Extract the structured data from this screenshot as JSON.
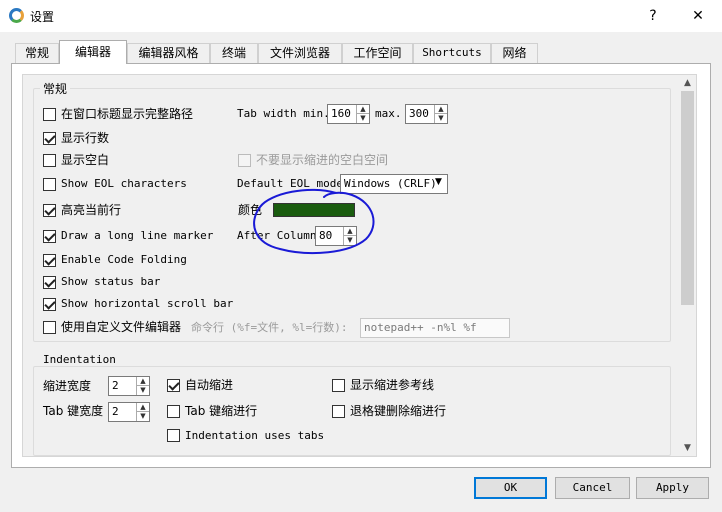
{
  "window": {
    "title": "设置",
    "help": "?",
    "close": "✕"
  },
  "tabs": [
    "常规",
    "编辑器",
    "编辑器风格",
    "终端",
    "文件浏览器",
    "工作空间",
    "Shortcuts",
    "网络"
  ],
  "general": {
    "title": "常规",
    "show_full_path": {
      "label": "在窗口标题显示完整路径",
      "checked": false
    },
    "tab_width_min_label": "Tab width min.",
    "tab_width_min": "160",
    "tab_width_max_label": "max.",
    "tab_width_max": "300",
    "show_line_numbers": {
      "label": "显示行数",
      "checked": true
    },
    "show_whitespace": {
      "label": "显示空白",
      "checked": false
    },
    "hide_indent_whitespace": {
      "label": "不要显示缩进的空白空间",
      "checked": false
    },
    "show_eol": {
      "label": "Show EOL characters",
      "checked": false
    },
    "default_eol_label": "Default EOL mode",
    "default_eol_value": "Windows (CRLF)",
    "highlight_line": {
      "label": "高亮当前行",
      "checked": true
    },
    "color_label": "颜色",
    "highlight_color": "#1a5c0f",
    "long_line_marker": {
      "label": "Draw a long line marker",
      "checked": true
    },
    "after_column_label": "After Column",
    "after_column_value": "80",
    "code_folding": {
      "label": "Enable Code Folding",
      "checked": true
    },
    "status_bar": {
      "label": "Show status bar",
      "checked": true
    },
    "horizontal_scroll": {
      "label": "Show horizontal scroll bar",
      "checked": true
    },
    "custom_editor": {
      "label": "使用自定义文件编辑器",
      "checked": false
    },
    "command_label": "命令行 (%f=文件, %l=行数):",
    "command_value": "notepad++ -n%l %f"
  },
  "indentation": {
    "title": "Indentation",
    "indent_width_label": "缩进宽度",
    "indent_width": "2",
    "tab_width_label": "Tab 键宽度",
    "tab_width": "2",
    "auto_indent": {
      "label": "自动缩进",
      "checked": true
    },
    "tab_indent": {
      "label": "Tab 键缩进行",
      "checked": false
    },
    "indentation_uses_tabs": {
      "label": "Indentation uses tabs",
      "checked": false
    },
    "show_indent_guides": {
      "label": "显示缩进参考线",
      "checked": false
    },
    "backspace_unindent": {
      "label": "退格键删除缩进行",
      "checked": false
    }
  },
  "buttons": {
    "ok": "OK",
    "cancel": "Cancel",
    "apply": "Apply"
  },
  "colors": {
    "accent": "#0078d7",
    "annotation": "#1a1ad6"
  }
}
